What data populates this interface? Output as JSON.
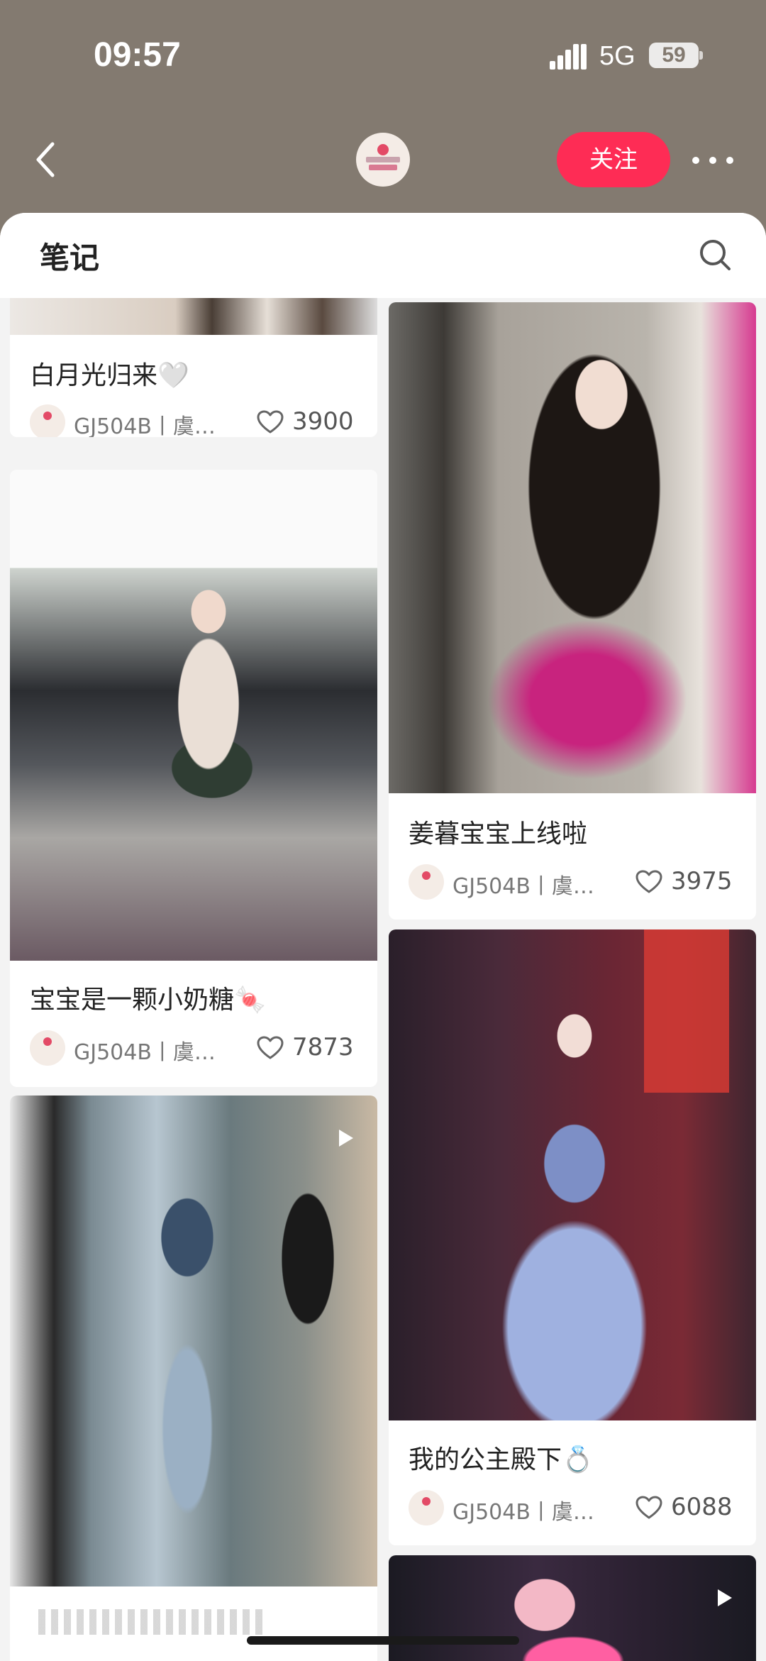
{
  "status_bar": {
    "time": "09:57",
    "network": "5G",
    "battery": "59"
  },
  "profile": {
    "follow_label": "关注",
    "avatar_text": "GJ504B"
  },
  "tab": {
    "title": "笔记"
  },
  "notes": [
    {
      "title": "白月光归来🤍",
      "author": "GJ504B丨虞…",
      "likes": "3900"
    },
    {
      "title": "姜暮宝宝上线啦",
      "author": "GJ504B丨虞…",
      "likes": "3975"
    },
    {
      "title": "宝宝是一颗小奶糖🍬",
      "author": "GJ504B丨虞…",
      "likes": "7873"
    },
    {
      "title": "我的公主殿下💍",
      "author": "GJ504B丨虞…",
      "likes": "6088"
    }
  ],
  "colors": {
    "accent": "#fe2c55",
    "header_bg": "#837a70",
    "feed_bg": "#f3f3f3"
  },
  "icons": [
    "back-icon",
    "more-icon",
    "search-icon",
    "heart-icon",
    "play-icon",
    "signal-icon"
  ]
}
